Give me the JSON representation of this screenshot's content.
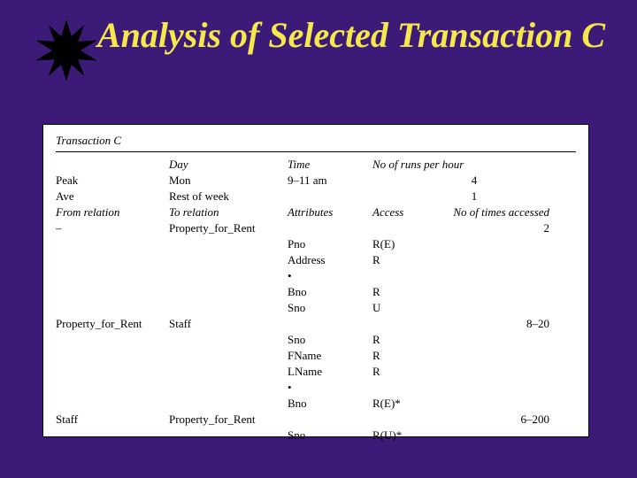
{
  "title": "Analysis of Selected Transaction C",
  "table": {
    "header_label": "Transaction C",
    "top_headers": {
      "day": "Day",
      "time": "Time",
      "runs": "No of runs per hour"
    },
    "peak": {
      "label": "Peak",
      "day": "Mon",
      "time": "9–11 am",
      "runs": "4"
    },
    "ave": {
      "label": "Ave",
      "day": "Rest of week",
      "time": "",
      "runs": "1"
    },
    "mid_headers": {
      "from": "From relation",
      "to": "To relation",
      "attr": "Attributes",
      "access": "Access",
      "times": "No of times accessed"
    },
    "groups": [
      {
        "from": "–",
        "to": "Property_for_Rent",
        "times": "2",
        "rows": [
          {
            "attr": "Pno",
            "access": "R(E)"
          },
          {
            "attr": "Address",
            "access": "R"
          },
          {
            "attr": "•",
            "access": ""
          },
          {
            "attr": "Bno",
            "access": "R"
          },
          {
            "attr": "Sno",
            "access": "U"
          }
        ]
      },
      {
        "from": "Property_for_Rent",
        "to": "Staff",
        "times": "8–20",
        "rows": [
          {
            "attr": "Sno",
            "access": "R"
          },
          {
            "attr": "FName",
            "access": "R"
          },
          {
            "attr": "LName",
            "access": "R"
          },
          {
            "attr": "•",
            "access": ""
          },
          {
            "attr": "Bno",
            "access": "R(E)*"
          }
        ]
      },
      {
        "from": "Staff",
        "to": "Property_for_Rent",
        "times": "6–200",
        "rows": [
          {
            "attr": "Sno",
            "access": "R(U)*"
          }
        ]
      }
    ]
  }
}
